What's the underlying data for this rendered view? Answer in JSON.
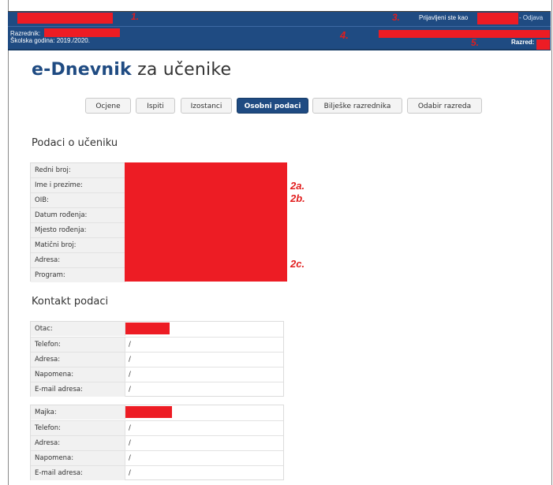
{
  "header": {
    "login_text": "Prijavljeni ste kao",
    "logout_text": "- Odjava",
    "teacher_label": "Razrednik:",
    "school_year_text": "Školska godina: 2019./2020.",
    "class_label": "Razred:",
    "annotation_color": "#e11d1d",
    "redaction_color": "#ed1c24",
    "bar_color": "#1f4b82"
  },
  "annotations": {
    "a1": "1.",
    "a3": "3.",
    "a4": "4.",
    "a5": "5.",
    "a2a": "2a.",
    "a2b": "2b.",
    "a2c": "2c."
  },
  "title": {
    "brand": "e-Dnevnik",
    "rest": " za učenike"
  },
  "tabs": [
    {
      "label": "Ocjene",
      "active": false
    },
    {
      "label": "Ispiti",
      "active": false
    },
    {
      "label": "Izostanci",
      "active": false
    },
    {
      "label": "Osobni podaci",
      "active": true
    },
    {
      "label": "Bilješke razrednika",
      "active": false
    },
    {
      "label": "Odabir razreda",
      "active": false
    }
  ],
  "student_section": {
    "heading": "Podaci o učeniku",
    "fields": [
      "Redni broj:",
      "Ime i prezime:",
      "OIB:",
      "Datum rođenja:",
      "Mjesto rođenja:",
      "Matični broj:",
      "Adresa:",
      "Program:"
    ]
  },
  "contact_section": {
    "heading": "Kontakt podaci",
    "father": {
      "rows": [
        {
          "label": "Otac:",
          "value": ""
        },
        {
          "label": "Telefon:",
          "value": "/"
        },
        {
          "label": "Adresa:",
          "value": "/"
        },
        {
          "label": "Napomena:",
          "value": "/"
        },
        {
          "label": "E-mail adresa:",
          "value": "/"
        }
      ]
    },
    "mother": {
      "rows": [
        {
          "label": "Majka:",
          "value": ""
        },
        {
          "label": "Telefon:",
          "value": "/"
        },
        {
          "label": "Adresa:",
          "value": "/"
        },
        {
          "label": "Napomena:",
          "value": "/"
        },
        {
          "label": "E-mail adresa:",
          "value": "/"
        }
      ]
    }
  }
}
